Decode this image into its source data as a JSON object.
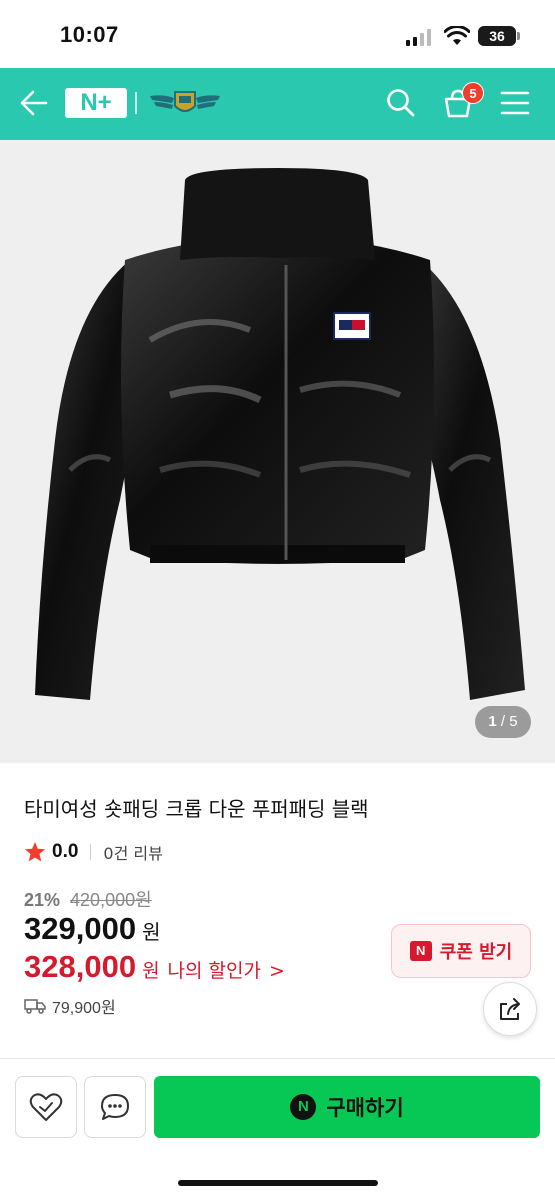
{
  "status_bar": {
    "time": "10:07",
    "battery": "36"
  },
  "header": {
    "logo_text": "N+",
    "cart_count": "5",
    "accent_color": "#2bc8b0",
    "icons": [
      "back-arrow-icon",
      "wings-emblem-icon",
      "search-icon",
      "cart-icon",
      "menu-icon"
    ]
  },
  "gallery": {
    "current": "1",
    "total": "/ 5"
  },
  "product": {
    "title": "타미여성 숏패딩 크롭 다운 푸퍼패딩 블랙",
    "rating": "0.0",
    "review_count": "0건 리뷰",
    "discount_percent": "21%",
    "original_price": "420,000원",
    "price": "329,000",
    "price_unit": "원",
    "my_price": "328,000",
    "my_price_unit": "원",
    "my_price_label": "나의 할인가",
    "my_price_chevron": ">",
    "shipping_fee": "79,900원"
  },
  "coupon": {
    "badge": "N",
    "label": "쿠폰 받기"
  },
  "bottom_bar": {
    "buy_badge": "N",
    "buy_label": "구매하기"
  },
  "colors": {
    "price_red": "#d6192c",
    "buy_green": "#07c755",
    "star": "#f23c2e"
  }
}
